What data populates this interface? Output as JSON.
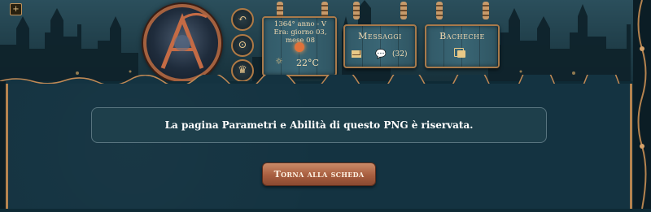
{
  "header": {
    "sidebar_toggle_icon": "plus-icon",
    "emblem_letter": "A",
    "nav_icons": [
      "back-arrow-icon",
      "map-pin-icon",
      "crown-icon"
    ],
    "date_panel": {
      "date_text": "1364° anno - V Era: giorno 03, mese 08",
      "temperature": "22°C",
      "weather_icon": "sun-cloud-icon",
      "moon_icon": "moon-phase-icon"
    },
    "messages_panel": {
      "title": "Messaggi",
      "mail_icon": "mail-icon",
      "chat_icon": "chat-icon",
      "count": "(32)"
    },
    "boards_panel": {
      "title": "Bacheche",
      "notes_icon": "notes-icon"
    }
  },
  "main": {
    "notice_text": "La pagina Parametri e Abilità di questo PNG è riservata.",
    "back_button_label": "Torna alla scheda"
  },
  "colors": {
    "background": "#143341",
    "accent": "#b5834f",
    "button": "#a85e3f"
  }
}
